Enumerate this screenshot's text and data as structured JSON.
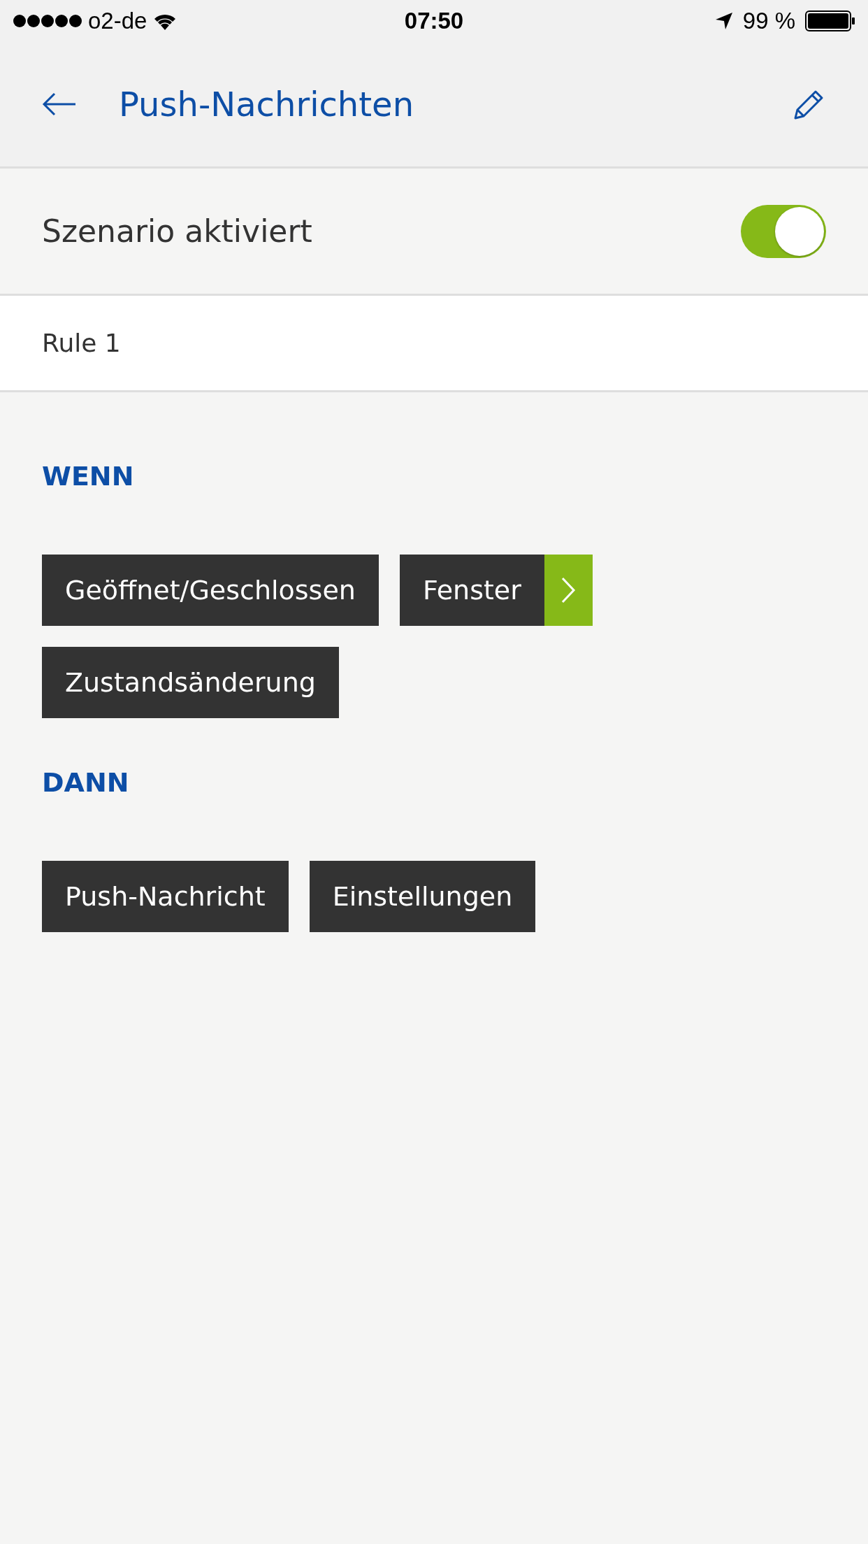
{
  "status_bar": {
    "carrier": "o2-de",
    "time": "07:50",
    "battery": "99 %"
  },
  "nav": {
    "title": "Push-Nachrichten"
  },
  "toggle": {
    "label": "Szenario aktiviert",
    "on": true
  },
  "rule": {
    "name": "Rule 1"
  },
  "sections": [
    {
      "heading": "WENN",
      "chips": [
        {
          "label": "Geöffnet/Geschlossen",
          "has_arrow": false
        },
        {
          "label": "Fenster",
          "has_arrow": true
        },
        {
          "label": "Zustandsänderung",
          "has_arrow": false
        }
      ]
    },
    {
      "heading": "DANN",
      "chips": [
        {
          "label": "Push-Nachricht",
          "has_arrow": false
        },
        {
          "label": "Einstellungen",
          "has_arrow": false
        }
      ]
    }
  ]
}
